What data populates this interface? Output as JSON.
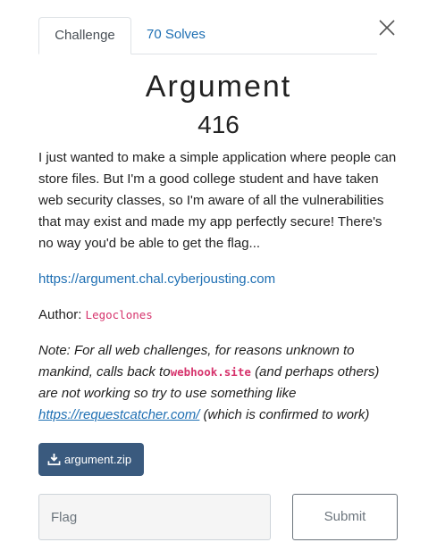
{
  "tabs": [
    {
      "label": "Challenge"
    },
    {
      "label": "70 Solves"
    }
  ],
  "challenge": {
    "name": "Argument",
    "points": "416",
    "description": "I just wanted to make a simple application where people can store files. But I'm a good college student and have taken web security classes, so I'm aware of all the vulnerabilities that may exist and made my app perfectly secure! There's no way you'd be able to get the flag...",
    "url": "https://argument.chal.cyberjousting.com",
    "author_label": "Author:",
    "author": "Legoclones",
    "note": {
      "part1": "Note: For all web challenges, for reasons unknown to mankind, calls back to",
      "code": "webhook.site",
      "part2": "(and perhaps others) are not working so try to use something like",
      "link": "https://requestcatcher.com/",
      "part3": "(which is confirmed to work)"
    },
    "file": "argument.zip"
  },
  "form": {
    "flag_placeholder": "Flag",
    "submit_label": "Submit"
  },
  "icons": {
    "close": "close-icon",
    "download": "download-icon"
  }
}
